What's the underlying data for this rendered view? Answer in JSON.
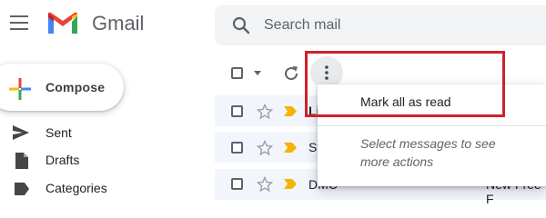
{
  "app": {
    "name": "Gmail",
    "logo_icon": "gmail-m-logo-icon",
    "colors": {
      "red": "#EA4335",
      "blue": "#4285F4",
      "green": "#34A853",
      "yellow": "#FBBC04",
      "highlight": "#D0212B"
    }
  },
  "header": {
    "menu_icon": "hamburger-menu-icon",
    "search": {
      "placeholder": "Search mail",
      "icon": "search-icon"
    }
  },
  "compose": {
    "label": "Compose",
    "icon": "plus-icon"
  },
  "sidebar": {
    "items": [
      {
        "label": "Sent",
        "icon": "send-icon"
      },
      {
        "label": "Drafts",
        "icon": "draft-icon"
      },
      {
        "label": "Categories",
        "icon": "label-icon"
      }
    ]
  },
  "toolbar": {
    "select_icon": "checkbox-icon",
    "select_dropdown_icon": "chevron-down-icon",
    "refresh_icon": "refresh-icon",
    "more_icon": "more-vertical-icon"
  },
  "messages": [
    {
      "sender": "Li"
    },
    {
      "sender": "St"
    },
    {
      "sender": "DMC",
      "subject": "New Free F"
    }
  ],
  "more_menu": {
    "items": [
      {
        "label": "Mark all as read"
      }
    ],
    "help_text": "Select messages to see more actions"
  }
}
